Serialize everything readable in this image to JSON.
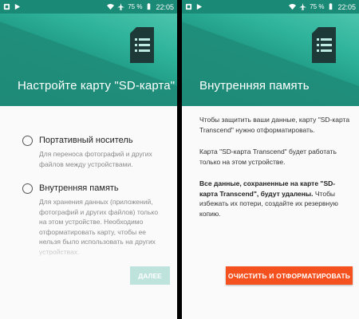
{
  "status_bar": {
    "battery": "75 %",
    "time": "22:05"
  },
  "colors": {
    "header": "#218a7a",
    "accent_disabled": "#bde3dc",
    "format_button": "#f4511e"
  },
  "left_screen": {
    "title": "Настройте карту \"SD-карта\"",
    "options": [
      {
        "label": "Портативный носитель",
        "description": "Для переноса фотографий и других файлов между устройствами."
      },
      {
        "label": "Внутренняя память",
        "description": "Для хранения данных (приложений, фотографий и других файлов) только на этом устройстве. Необходимо отформатировать карту, чтобы ее нельзя было использовать на других устройствах."
      }
    ],
    "next_button": "ДАЛЕЕ"
  },
  "right_screen": {
    "title": "Внутренняя память",
    "paragraph1": "Чтобы защитить ваши данные, карту \"SD-карта Transcend\" нужно отформатировать.",
    "paragraph2": "Карта \"SD-карта Transcend\" будет работать только на этом устройстве.",
    "paragraph3_bold": "Все данные, сохраненные на карте \"SD-карта Transcend\", будут удалены.",
    "paragraph3_rest": "Чтобы избежать их потери, создайте их резервную копию.",
    "format_button": "ОЧИСТИТЬ И ОТФОРМАТИРОВАТЬ"
  }
}
